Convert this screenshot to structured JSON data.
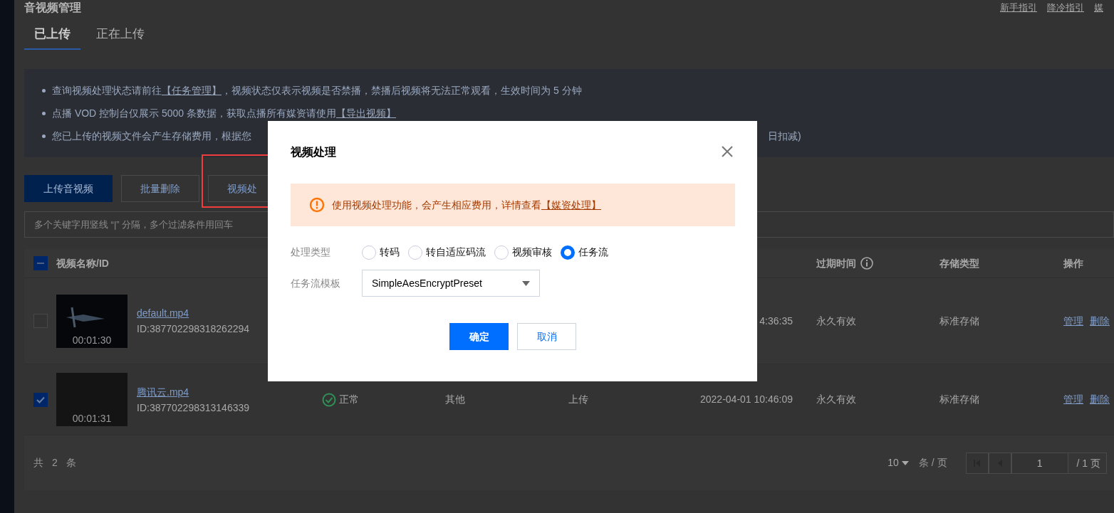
{
  "page": {
    "title": "音视频管理",
    "header_links": [
      "新手指引",
      "降冷指引",
      "媒"
    ]
  },
  "tabs": [
    {
      "label": "已上传",
      "selected": true
    },
    {
      "label": "正在上传",
      "selected": false
    }
  ],
  "notices": [
    {
      "segments": [
        {
          "kind": "text",
          "text": "查询视频处理状态请前往"
        },
        {
          "kind": "link",
          "text": "【任务管理】"
        },
        {
          "kind": "text",
          "text": "，视频状态仅表示视频是否禁播，禁播后视频将无法正常观看，生效时间为 5 分钟"
        }
      ]
    },
    {
      "segments": [
        {
          "kind": "text",
          "text": "点播 VOD 控制台仅展示 5000 条数据，获取点播所有媒资请使用"
        },
        {
          "kind": "link",
          "text": "【导出视频】"
        }
      ]
    },
    {
      "segments": [
        {
          "kind": "text",
          "text": "您已上传的视频文件会产生存储费用，根据您"
        },
        {
          "kind": "covered"
        },
        {
          "kind": "text",
          "text": "日扣减)"
        }
      ]
    }
  ],
  "toolbar": [
    {
      "label": "上传音视频",
      "kind": "primary"
    },
    {
      "label": "批量删除",
      "kind": "default"
    },
    {
      "label": "视频处",
      "kind": "default"
    }
  ],
  "search": {
    "placeholder": "多个关键字用竖线 “|” 分隔，多个过滤条件用回车"
  },
  "table": {
    "indeterminate": true,
    "columns": [
      {
        "kind": "name",
        "label": "视频名称/ID"
      },
      {
        "kind": "status"
      },
      {
        "kind": "text"
      },
      {
        "kind": "text"
      },
      {
        "kind": "time"
      },
      {
        "kind": "text",
        "label": "过期时间",
        "info": true
      },
      {
        "kind": "text",
        "label": "存储类型"
      },
      {
        "kind": "actions",
        "label": "操作"
      }
    ],
    "rows": [
      {
        "selected": false,
        "cells": [
          {
            "name": "default.mp4",
            "id": "ID:387702298318262294",
            "thumbnail": {
              "kind": "figure",
              "duration": "00:01:30"
            }
          },
          "",
          "",
          "",
          "4:36:35",
          "永久有效",
          "标准存储",
          [
            "管理",
            "删除"
          ]
        ]
      },
      {
        "selected": true,
        "cells": [
          {
            "name": "腾讯云.mp4",
            "id": "ID:387702298313146339",
            "thumbnail": {
              "kind": "dark",
              "duration": "00:01:31"
            }
          },
          "正常",
          "其他",
          "上传",
          "2022-04-01 10:46:09",
          "永久有效",
          "标准存储",
          [
            "管理",
            "删除"
          ]
        ]
      }
    ]
  },
  "pagination": {
    "total": "共 2 条",
    "page_size": "10",
    "per_page": "条 / 页",
    "page": "1",
    "page_total": "/ 1 页"
  },
  "modal": {
    "title": "视频处理",
    "alert": {
      "text": "使用视频处理功能，会产生相应费用，详情查看",
      "link": "【媒资处理】"
    },
    "type_label": "处理类型",
    "types": [
      {
        "label": "转码",
        "selected": false
      },
      {
        "label": "转自适应码流",
        "selected": false
      },
      {
        "label": "视频审核",
        "selected": false
      },
      {
        "label": "任务流",
        "selected": true
      }
    ],
    "template_label": "任务流模板",
    "template_value": "SimpleAesEncryptPreset",
    "buttons": [
      {
        "label": "确定",
        "kind": "primary"
      },
      {
        "label": "取消",
        "kind": "default"
      }
    ]
  }
}
